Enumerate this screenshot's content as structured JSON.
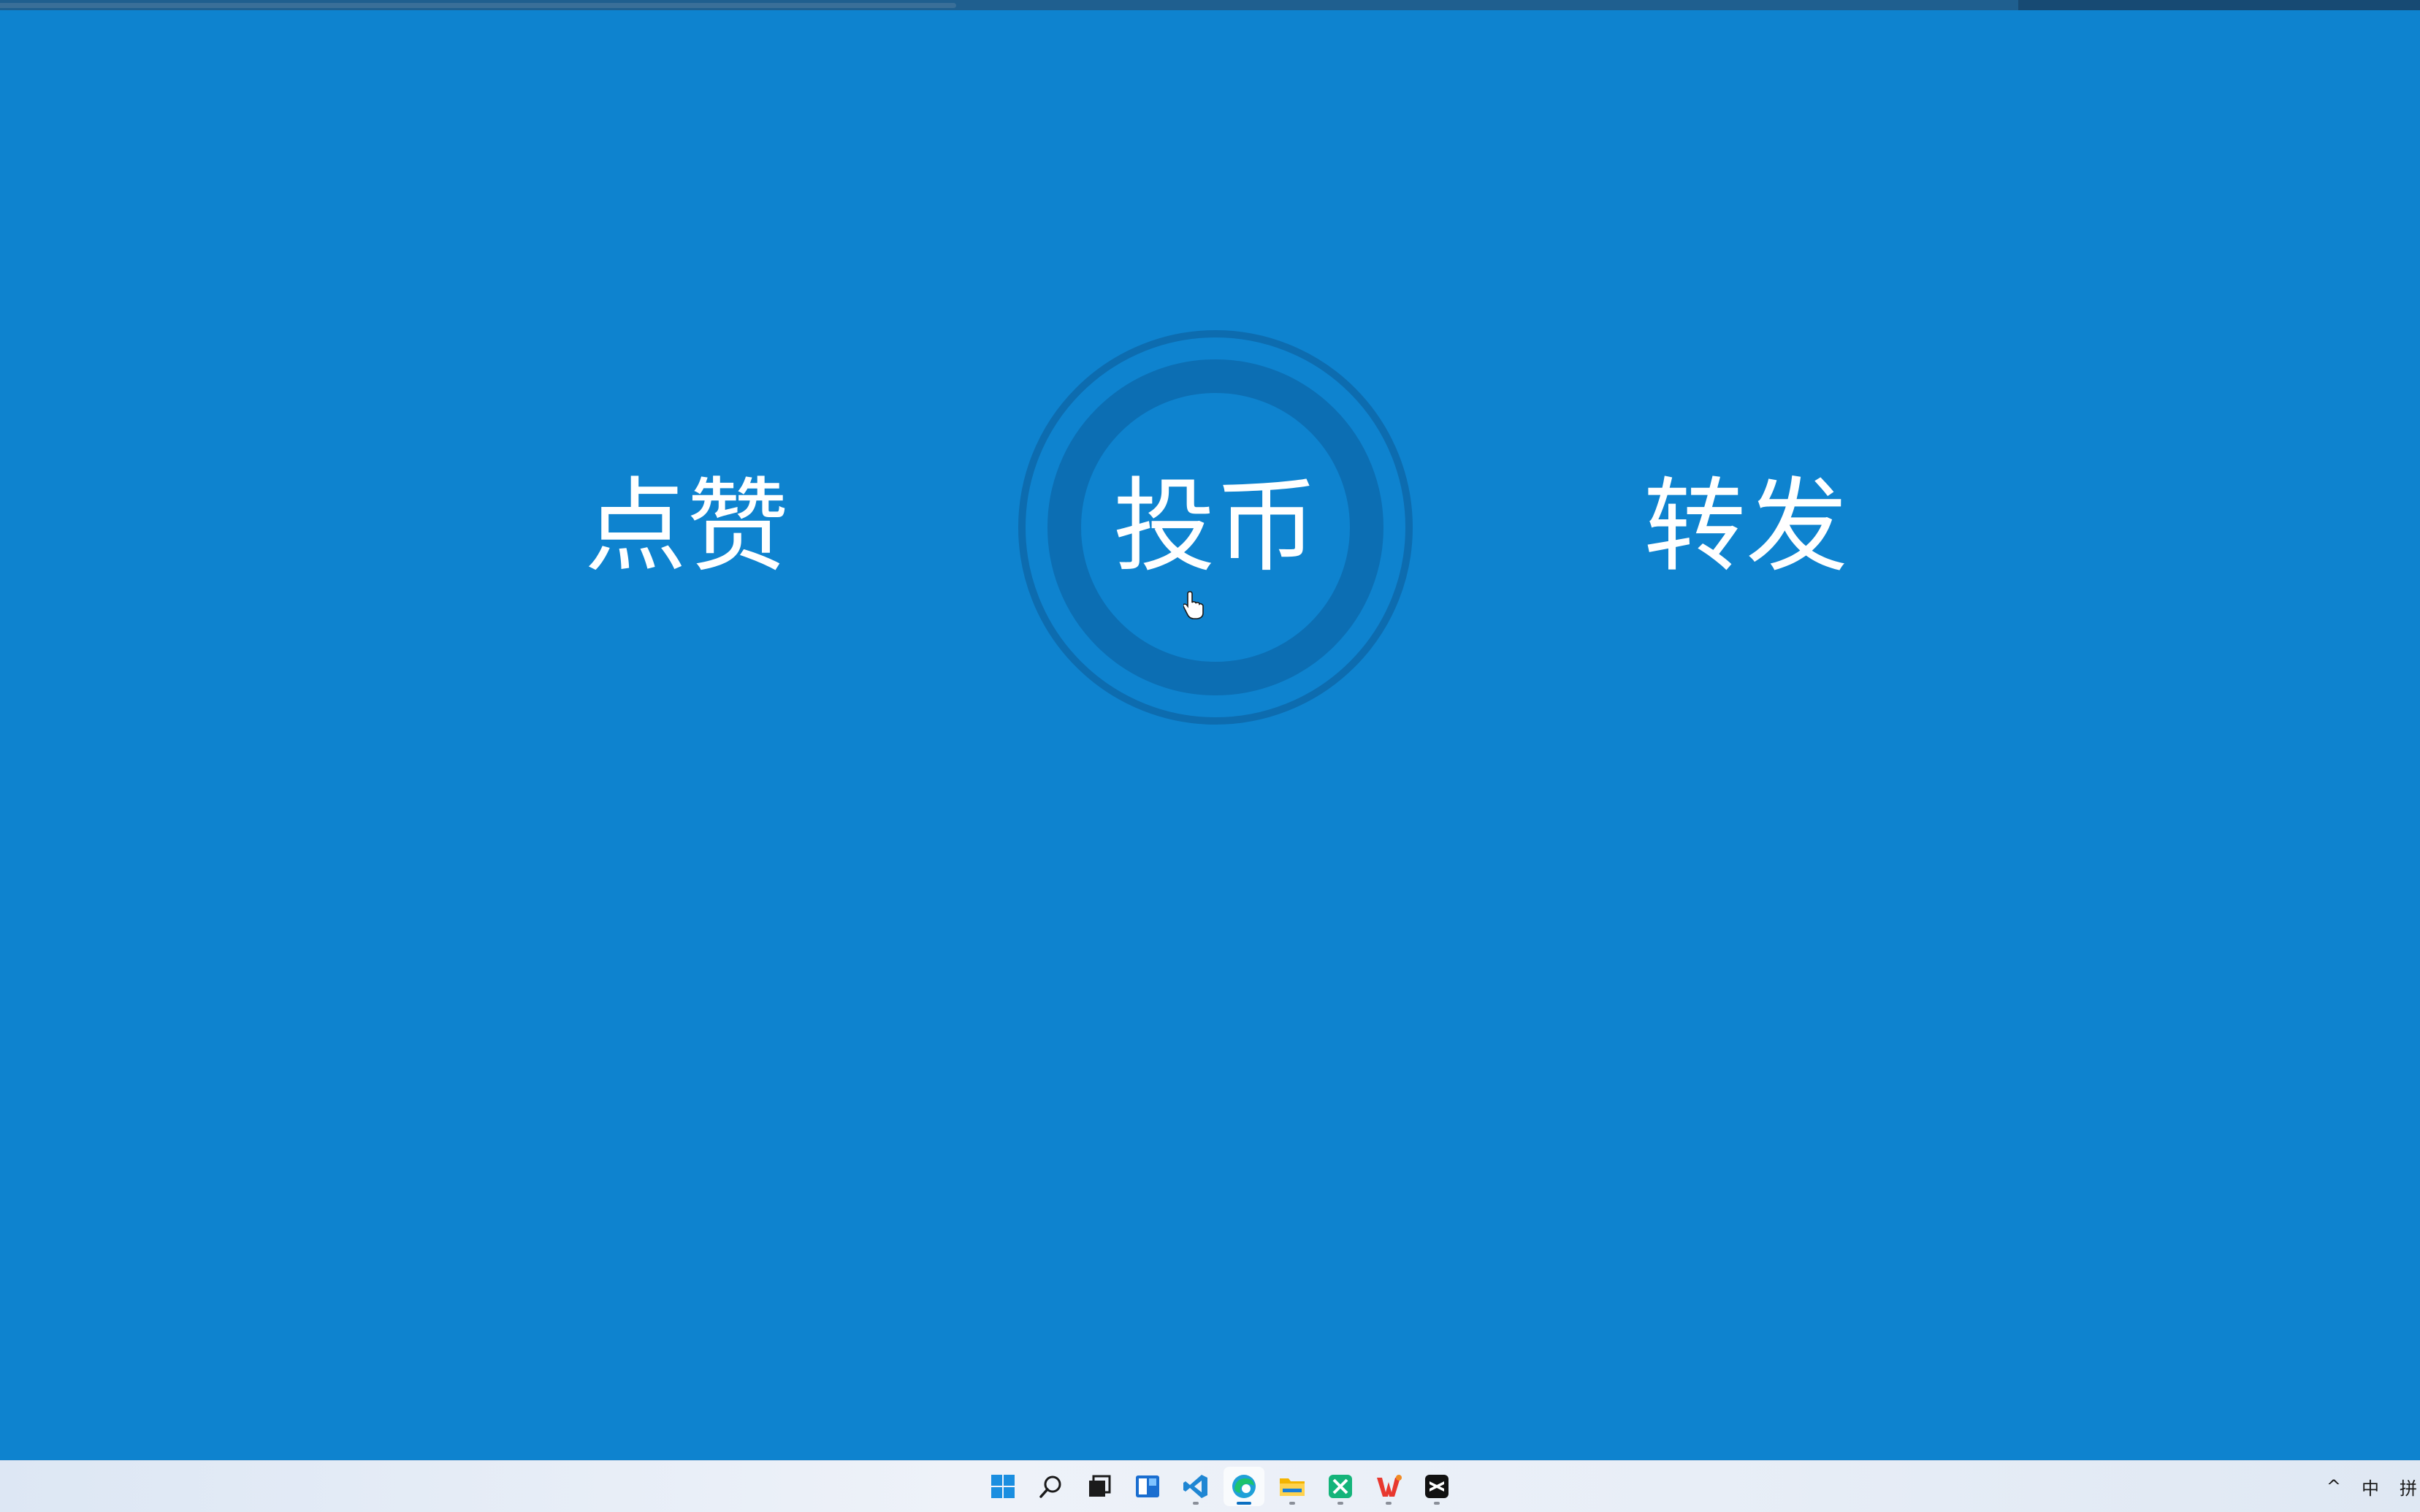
{
  "app": {
    "actions": {
      "like_label": "点赞",
      "coin_label": "投币",
      "share_label": "转发"
    }
  },
  "top_bar": {
    "progress_fraction": 0.395
  },
  "colors": {
    "background": "#0e83cf",
    "text": "#ffffff",
    "ring": "#0c5a96",
    "taskbar": "#e8eef7"
  },
  "taskbar": {
    "icons": [
      "windows-start-icon",
      "search-icon",
      "task-view-icon",
      "widgets-icon",
      "vscode-icon",
      "edge-icon",
      "file-explorer-icon",
      "app-green-icon",
      "wps-icon",
      "capcut-icon"
    ],
    "active_icon": "edge-icon",
    "tray": {
      "chevron": "^",
      "ime_mode": "中",
      "ime_name": "拼"
    }
  }
}
